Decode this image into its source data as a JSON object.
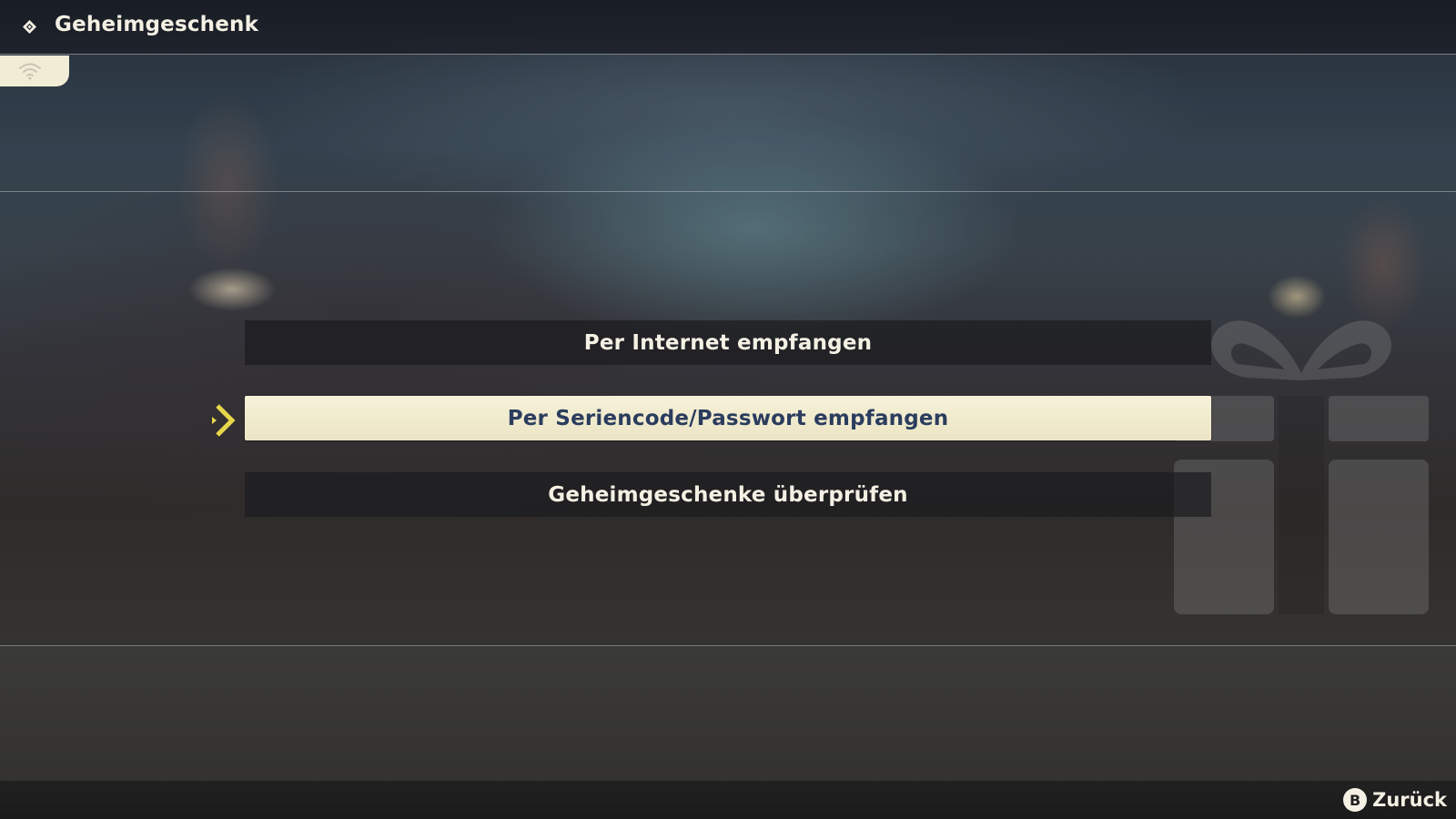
{
  "header": {
    "title": "Geheimgeschenk",
    "title_icon": "diamond-icon",
    "connection_icon": "wifi-icon"
  },
  "menu": {
    "items": [
      {
        "label": "Per Internet empfangen",
        "selected": false
      },
      {
        "label": "Per Seriencode/Passwort empfangen",
        "selected": true
      },
      {
        "label": "Geheimgeschenke überprüfen",
        "selected": false
      }
    ],
    "cursor_icon": "chevron-right-icon"
  },
  "decoration": {
    "icon": "gift-icon"
  },
  "footer": {
    "back": {
      "button_glyph": "B",
      "label": "Zurück"
    }
  },
  "colors": {
    "selected_bg": "#f0ead0",
    "selected_text": "#2b3d5e",
    "cursor": "#e8d64a",
    "text": "#f4f0e4"
  }
}
